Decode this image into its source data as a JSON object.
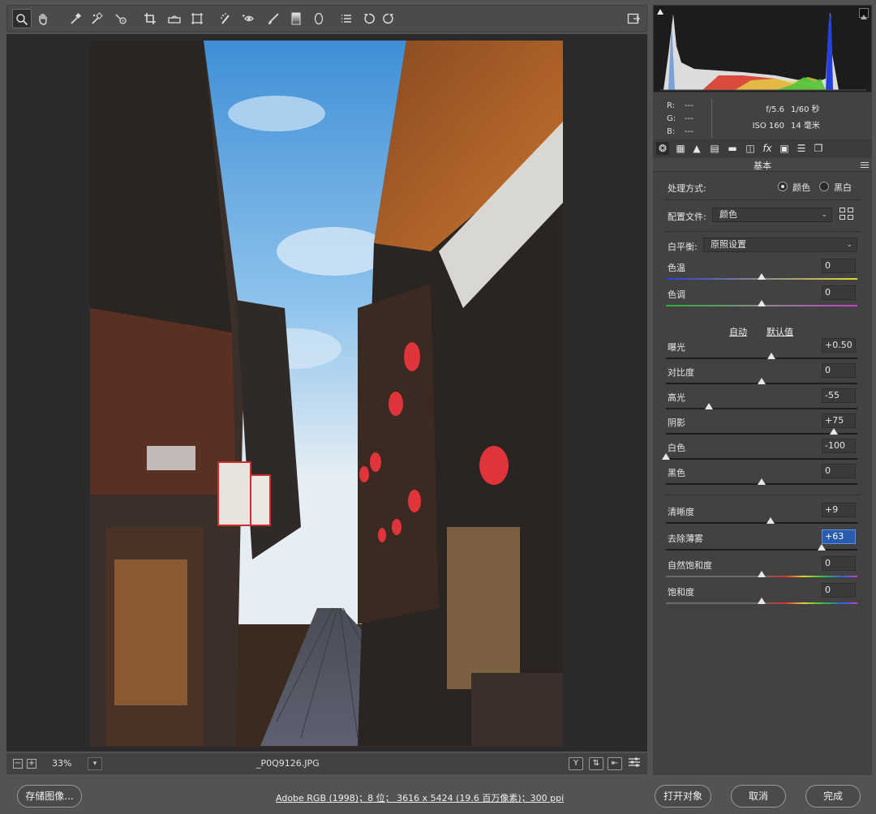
{
  "toolbar": {
    "tools": [
      "zoom-icon",
      "hand-icon",
      "white-balance-icon",
      "color-sampler-icon",
      "target-adjust-icon",
      "crop-icon",
      "straighten-icon",
      "transform-icon",
      "spot-removal-icon",
      "red-eye-icon",
      "adjustment-brush-icon",
      "graduated-filter-icon",
      "radial-filter-icon",
      "preferences-icon",
      "rotate-left-icon",
      "rotate-right-icon"
    ],
    "fullscreen_icon": "toggle-fullscreen-icon"
  },
  "status": {
    "zoom_minus": "−",
    "zoom_plus": "+",
    "zoom": "33%",
    "filename": "_P0Q9126.JPG",
    "view_y": "Y",
    "icons": [
      "before-after-icon",
      "swap-icon",
      "settings-icon"
    ]
  },
  "info": {
    "r_label": "R:",
    "g_label": "G:",
    "b_label": "B:",
    "r": "---",
    "g": "---",
    "b": "---",
    "aperture": "f/5.6",
    "shutter": "1/60 秒",
    "iso": "ISO 160",
    "focal": "14 毫米"
  },
  "panel": {
    "section_title": "基本",
    "treatment_label": "处理方式:",
    "treatment_color": "颜色",
    "treatment_bw": "黑白",
    "profile_label": "配置文件:",
    "profile_value": "颜色",
    "wb_label": "白平衡:",
    "wb_value": "原照设置",
    "auto": "自动",
    "default": "默认值"
  },
  "sliders": [
    {
      "label": "色温",
      "value": "0",
      "pos": 0.5,
      "track": "temp"
    },
    {
      "label": "色调",
      "value": "0",
      "pos": 0.5,
      "track": "tint"
    },
    {
      "label": "曝光",
      "value": "+0.50",
      "pos": 0.55,
      "track": "gray"
    },
    {
      "label": "对比度",
      "value": "0",
      "pos": 0.5,
      "track": "gray"
    },
    {
      "label": "高光",
      "value": "-55",
      "pos": 0.225,
      "track": "gray"
    },
    {
      "label": "阴影",
      "value": "+75",
      "pos": 0.875,
      "track": "gray"
    },
    {
      "label": "白色",
      "value": "-100",
      "pos": 0.0,
      "track": "gray"
    },
    {
      "label": "黑色",
      "value": "0",
      "pos": 0.5,
      "track": "gray"
    },
    {
      "label": "清晰度",
      "value": "+9",
      "pos": 0.545,
      "track": "gray"
    },
    {
      "label": "去除薄雾",
      "value": "+63",
      "pos": 0.815,
      "track": "gray",
      "focus": true
    },
    {
      "label": "自然饱和度",
      "value": "0",
      "pos": 0.5,
      "track": "sat"
    },
    {
      "label": "饱和度",
      "value": "0",
      "pos": 0.5,
      "track": "sat"
    }
  ],
  "footer": {
    "save": "存储图像...",
    "workflow": "Adobe RGB (1998)；8 位；  3616 x 5424 (19.6 百万像素)；300 ppi",
    "open": "打开对象",
    "cancel": "取消",
    "done": "完成"
  },
  "colors": {
    "sky": "#4a9ad8",
    "lantern": "#e0343a",
    "wood": "#b4642a"
  }
}
